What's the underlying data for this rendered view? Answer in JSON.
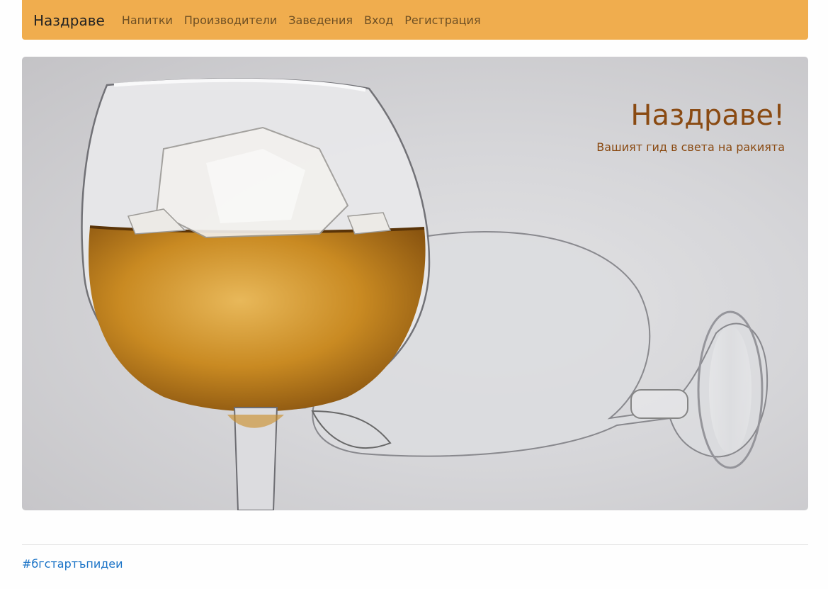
{
  "navbar": {
    "brand": "Наздраве",
    "links": [
      "Напитки",
      "Производители",
      "Заведения",
      "Вход",
      "Регистрация"
    ],
    "background_color": "#f0ad4e"
  },
  "hero": {
    "title": "Наздраве!",
    "subtitle": "Вашият гид в света на ракията",
    "text_color": "#8a4a12"
  },
  "footer": {
    "hashtag": "#бгстартъпидеи",
    "link_color": "#1a73c7"
  }
}
